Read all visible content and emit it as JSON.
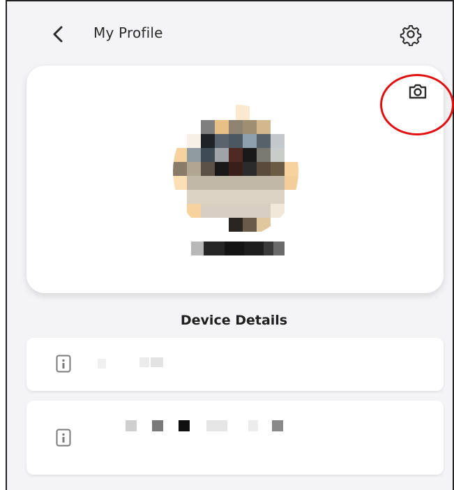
{
  "header": {
    "title": "My Profile",
    "back_icon": "chevron-left-icon",
    "settings_icon": "gear-icon"
  },
  "profile": {
    "camera_icon": "camera-icon",
    "highlight_color": "#e10f0f",
    "avatar_redacted": true,
    "name_redacted": true
  },
  "device_details": {
    "title": "Device Details",
    "device_icon": "info-device-icon",
    "items": [
      {
        "redacted": true
      },
      {
        "redacted": true
      }
    ]
  },
  "colors": {
    "background": "#f4f4f6",
    "card": "#ffffff",
    "text": "#2a2a2a"
  }
}
